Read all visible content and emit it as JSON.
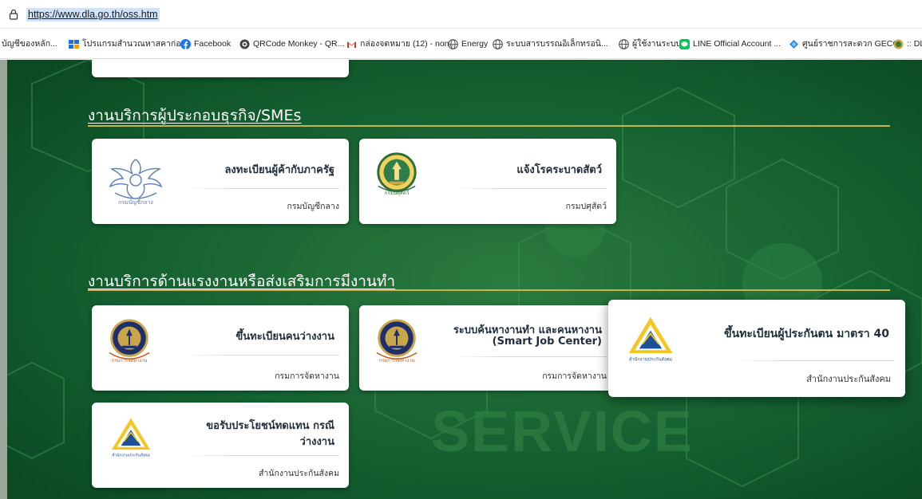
{
  "browser": {
    "url": "https://www.dla.go.th/oss.htm",
    "bookmarks": [
      {
        "label": "บัญชีของหลัก...",
        "icon": "none"
      },
      {
        "label": "โปรแกรมสำนวณหาสคาก่อ...",
        "icon": "ms-icon"
      },
      {
        "label": "Facebook",
        "icon": "facebook-icon"
      },
      {
        "label": "QRCode Monkey - QR...",
        "icon": "qr-icon"
      },
      {
        "label": "กล่องจดหมาย (12) - non...",
        "icon": "gmail-icon"
      },
      {
        "label": "Energy",
        "icon": "globe-icon"
      },
      {
        "label": "ระบบสารบรรณอิเล็กทรอนิ...",
        "icon": "globe-icon"
      },
      {
        "label": "ผู้ใช้งานระบบ",
        "icon": "globe-icon"
      },
      {
        "label": "LINE Official Account ...",
        "icon": "line-icon"
      },
      {
        "label": "ศูนย์ราชการสะดวก GECC",
        "icon": "gecc-icon"
      },
      {
        "label": ":: DL",
        "icon": "dla-icon"
      }
    ]
  },
  "sections": [
    {
      "title": "งานบริการผู้ประกอบธุรกิจ/SMEs",
      "cards": [
        {
          "title": "ลงทะเบียนผู้ค้ากับภาครัฐ",
          "agency": "กรมบัญชีกลาง",
          "logo": "garuda-logo"
        },
        {
          "title": "แจ้งโรคระบาดสัตว์",
          "agency": "กรมปศุสัตว์",
          "logo": "livestock-logo"
        }
      ]
    },
    {
      "title": "งานบริการด้านแรงงานหรือส่งเสริมการมีงานทำ",
      "cards": [
        {
          "title": "ขึ้นทะเบียนคนว่างงาน",
          "agency": "กรมการจัดหางาน",
          "logo": "employment-dept-logo"
        },
        {
          "title_line1": "ระบบค้นหางานทำ และคนหางาน",
          "title_line2": "(Smart Job Center)",
          "agency": "กรมการจัดหางาน",
          "logo": "employment-dept-logo"
        },
        {
          "title": "ขึ้นทะเบียนผู้ประกันตน มาตรา 40",
          "agency": "สำนักงานประกันสังคม",
          "logo": "sso-logo"
        },
        {
          "title_line1": "ขอรับประโยชน์ทดแทน กรณี",
          "title_line2": "ว่างงาน",
          "agency": "สำนักงานประกันสังคม",
          "logo": "sso-logo"
        }
      ]
    }
  ],
  "watermark": "SERVICE",
  "colors": {
    "page_bg": "#0e5a2c",
    "section_line": "#c6b54a",
    "card_bg": "#ffffff"
  }
}
